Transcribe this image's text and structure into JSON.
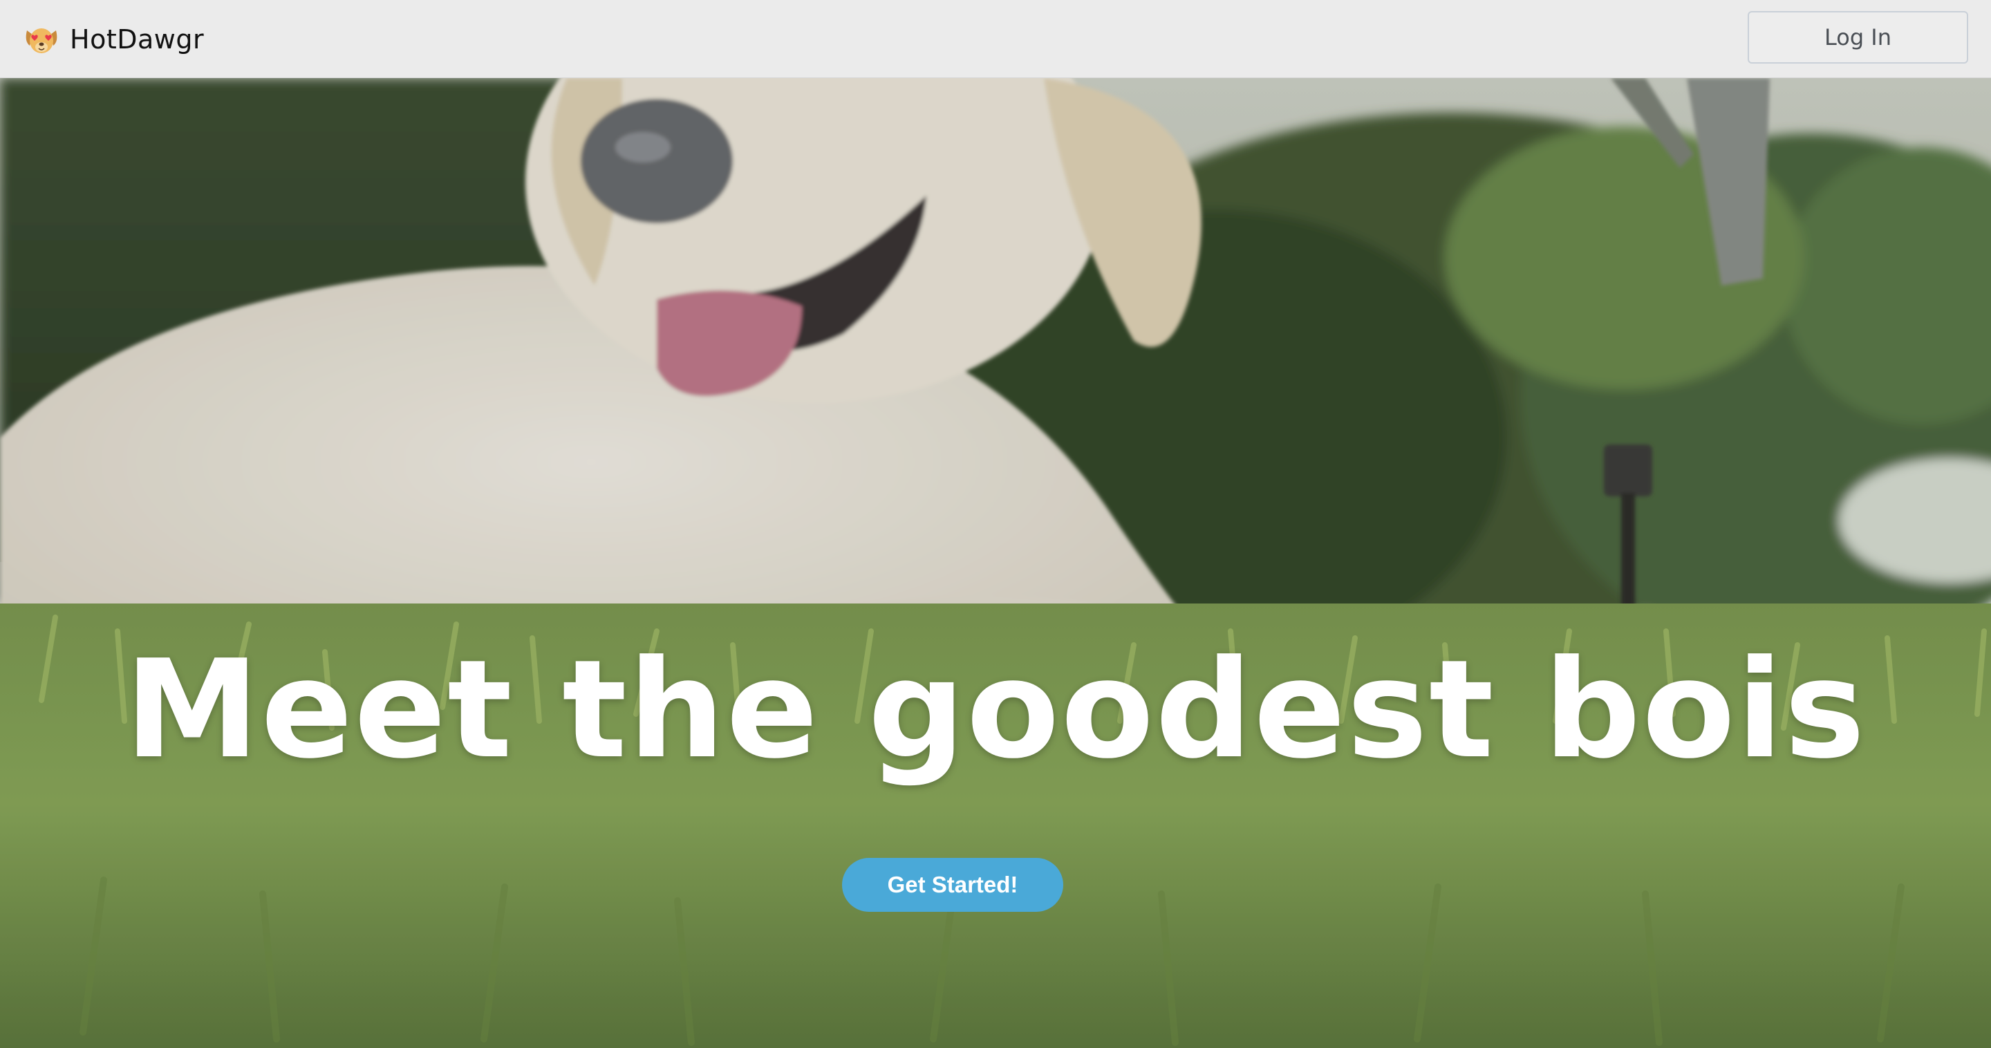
{
  "navbar": {
    "brand_name": "HotDawgr",
    "logo_icon": "dog-face-heart-eyes-icon",
    "login_label": "Log In"
  },
  "hero": {
    "headline": "Meet the goodest bois",
    "cta_label": "Get Started!",
    "background": "golden-retriever-puppy-lying-on-grass-photo"
  },
  "colors": {
    "navbar_bg": "#ebebeb",
    "cta_bg": "#4aa9d8",
    "headline_text": "#ffffff"
  }
}
